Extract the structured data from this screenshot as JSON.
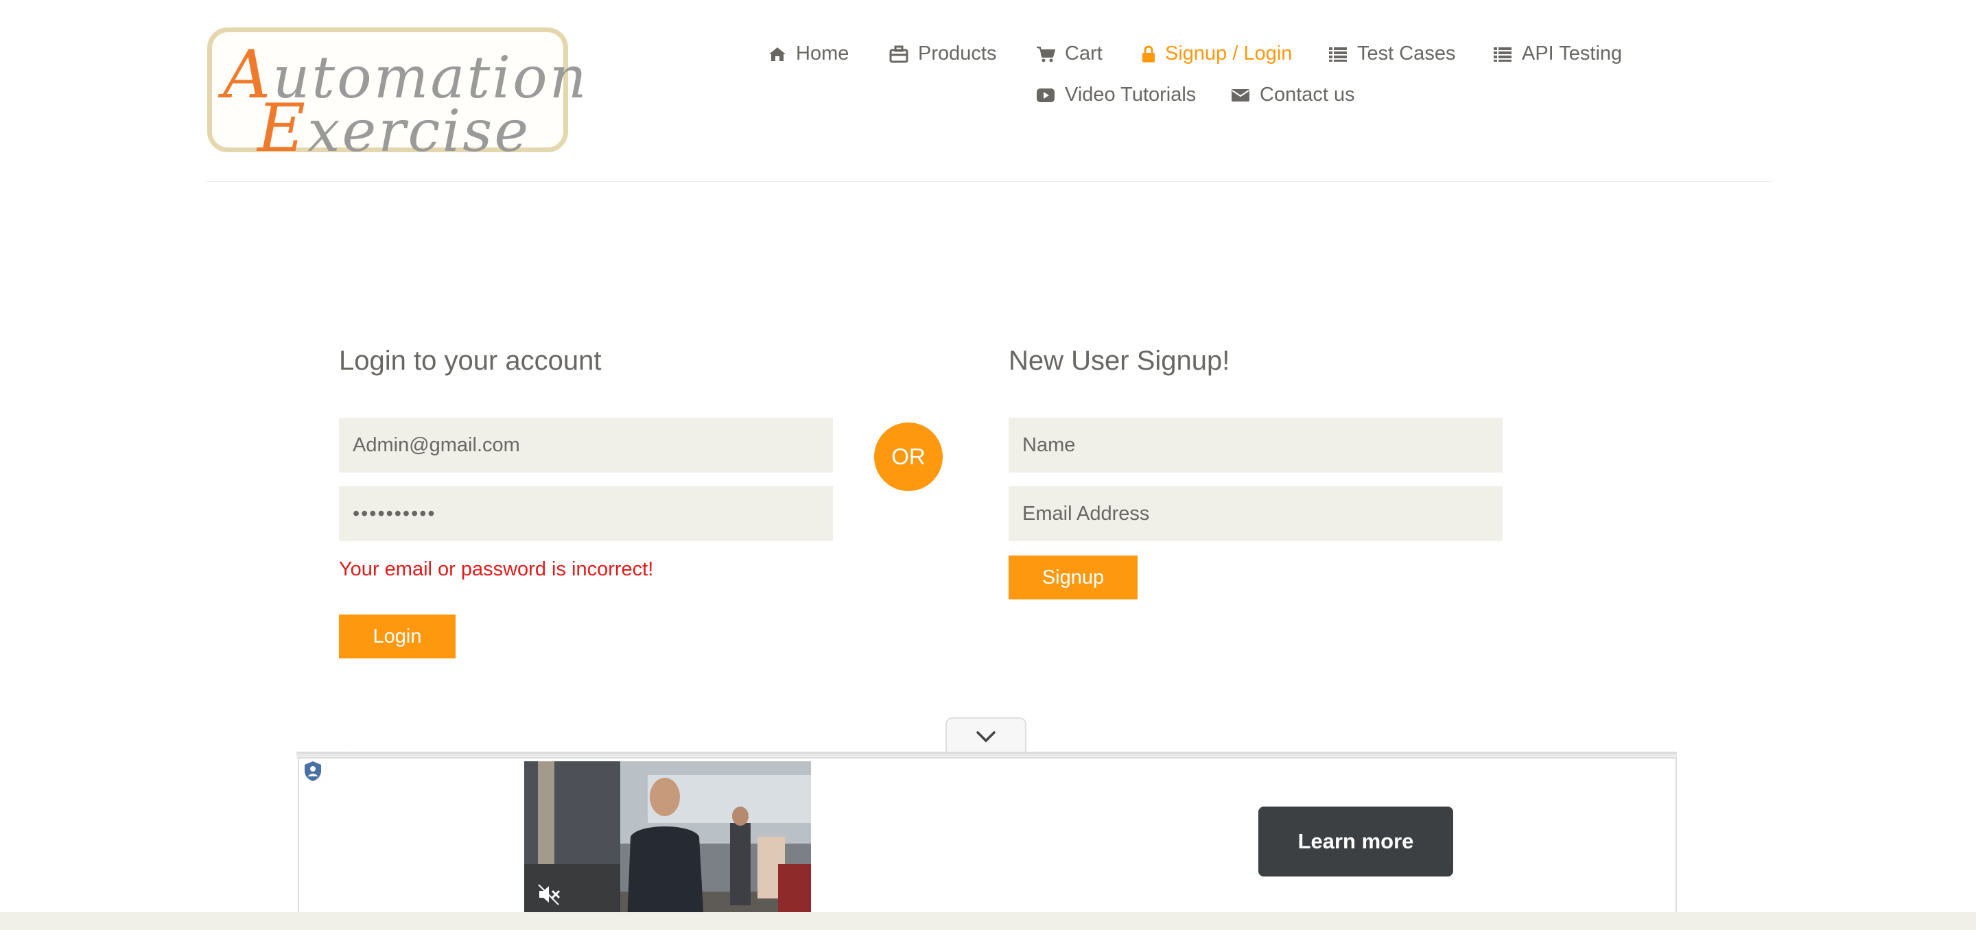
{
  "logo": {
    "line1_cap": "A",
    "line1_rest": "utomation",
    "line2_cap": "E",
    "line2_rest": "xercise"
  },
  "nav": {
    "items": [
      {
        "label": "Home",
        "icon": "home-icon"
      },
      {
        "label": "Products",
        "icon": "briefcase-icon"
      },
      {
        "label": "Cart",
        "icon": "cart-icon"
      },
      {
        "label": "Signup / Login",
        "icon": "lock-icon",
        "active": true
      },
      {
        "label": "Test Cases",
        "icon": "list-icon"
      },
      {
        "label": "API Testing",
        "icon": "list-icon"
      },
      {
        "label": "Video Tutorials",
        "icon": "youtube-play-icon"
      },
      {
        "label": "Contact us",
        "icon": "envelope-icon"
      }
    ]
  },
  "login": {
    "title": "Login to your account",
    "email_value": "Admin@gmail.com",
    "password_value": "1234567890",
    "error": "Your email or password is incorrect!",
    "button": "Login"
  },
  "divider": {
    "label": "OR"
  },
  "signup": {
    "title": "New User Signup!",
    "name_placeholder": "Name",
    "email_placeholder": "Email Address",
    "button": "Signup"
  },
  "ad": {
    "cta": "Learn more",
    "toggle_icon": "chevron-down-icon",
    "mute_icon": "muted-speaker-icon",
    "badge_icon": "ad-choices-icon"
  },
  "colors": {
    "accent": "#fe980f",
    "text": "#696763",
    "input_bg": "#f0f0e9",
    "error": "#e21a1a"
  }
}
